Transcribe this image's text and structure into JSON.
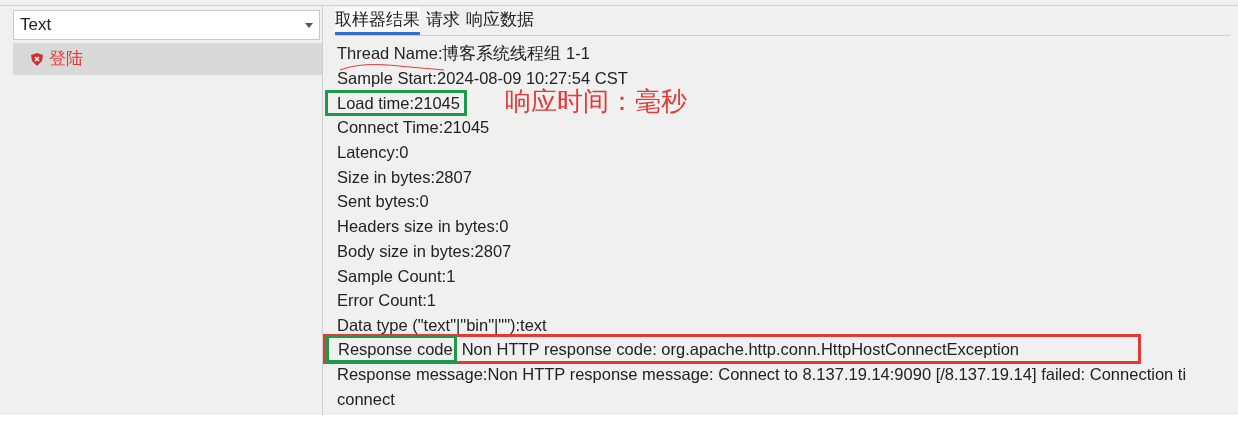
{
  "view_selector": {
    "value": "Text"
  },
  "tree": [
    {
      "label": "登陆",
      "selected": true,
      "failed": true
    }
  ],
  "tabs": [
    {
      "label": "取样器结果",
      "selected": true
    },
    {
      "label": "请求",
      "selected": false
    },
    {
      "label": "响应数据",
      "selected": false
    }
  ],
  "result_lines": [
    {
      "text": "Thread Name:博客系统线程组 1-1",
      "underlined": true
    },
    {
      "text": "Sample Start:2024-08-09 10:27:54 CST"
    },
    {
      "text": "Load time:21045",
      "boxed": true,
      "note": "响应时间：毫秒"
    },
    {
      "text": "Connect Time:21045"
    },
    {
      "text": "Latency:0"
    },
    {
      "text": "Size in bytes:2807"
    },
    {
      "text": "Sent bytes:0"
    },
    {
      "text": "Headers size in bytes:0"
    },
    {
      "text": "Body size in bytes:2807"
    },
    {
      "text": "Sample Count:1"
    },
    {
      "text": "Error Count:1"
    },
    {
      "text": "Data type (\"text\"|\"bin\"|\"\"):text"
    },
    {
      "label": "Response code",
      "text": "Non HTTP response code: org.apache.http.conn.HttpHostConnectException",
      "boxed": true
    },
    {
      "text": "Response message:Non HTTP response message: Connect to 8.137.19.14:9090 [/8.137.19.14] failed: Connection ti"
    },
    {
      "text": "connect"
    }
  ]
}
